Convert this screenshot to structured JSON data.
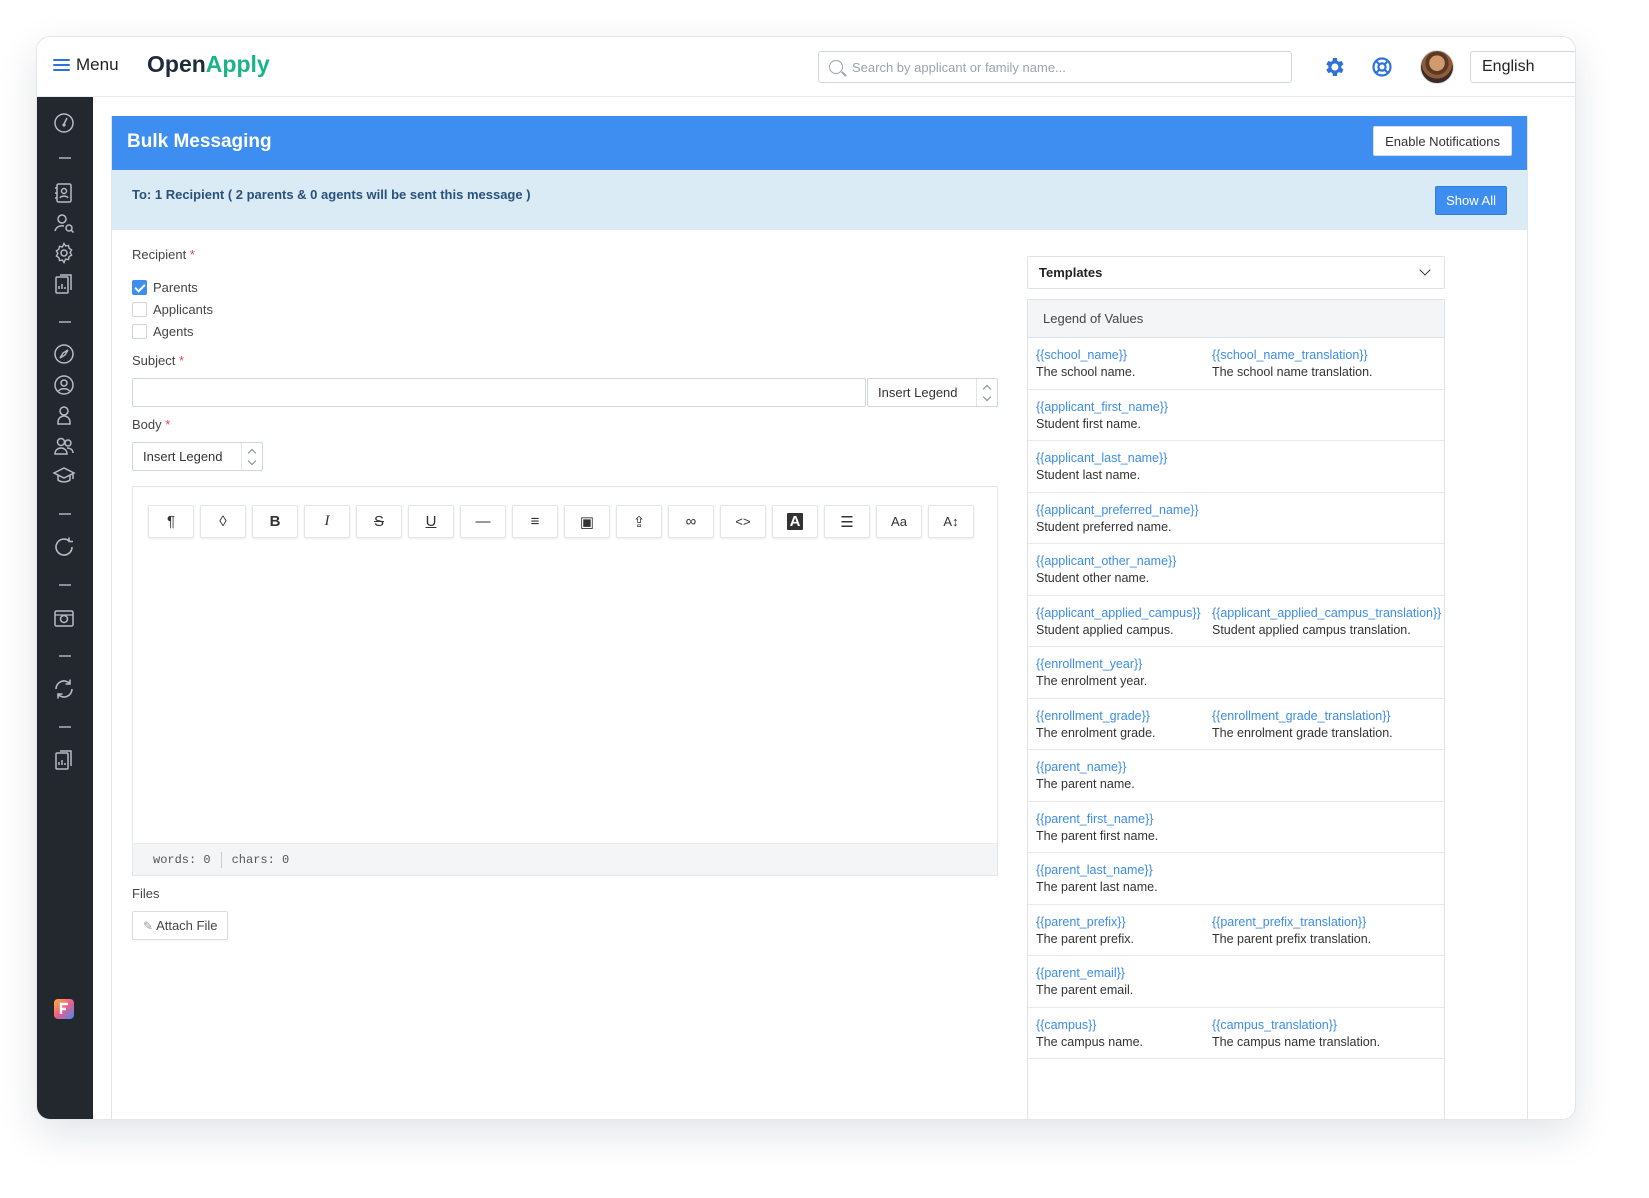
{
  "topbar": {
    "menu_label": "Menu",
    "logo_part1": "Open",
    "logo_part2": "Apply",
    "search_placeholder": "Search by applicant or family name...",
    "language": "English"
  },
  "page": {
    "title": "Bulk Messaging",
    "enable_notifications": "Enable Notifications",
    "recipient_summary": "To: 1 Recipient ( 2 parents & 0 agents will be sent this message )",
    "show_all": "Show All"
  },
  "form": {
    "recipient_label": "Recipient",
    "required_mark": "*",
    "recipients": [
      {
        "label": "Parents",
        "checked": true
      },
      {
        "label": "Applicants",
        "checked": false
      },
      {
        "label": "Agents",
        "checked": false
      }
    ],
    "subject_label": "Subject",
    "subject_value": "",
    "insert_legend": "Insert Legend",
    "body_label": "Body",
    "toolbar_glyphs": [
      "¶",
      "◊",
      "B",
      "I",
      "S",
      "U",
      "—",
      "≡",
      "▣",
      "⇪",
      "∞",
      "<>",
      "A",
      "☰",
      "Aa",
      "A↕"
    ],
    "words_label": "words: 0",
    "chars_label": "chars: 0",
    "files_label": "Files",
    "attach_file": "Attach File",
    "attach_glyph": "✎"
  },
  "templates": {
    "label": "Templates",
    "legend_title": "Legend of Values",
    "rows": [
      [
        {
          "key": "{{school_name}}",
          "desc": "The school name."
        },
        {
          "key": "{{school_name_translation}}",
          "desc": "The school name translation."
        }
      ],
      [
        {
          "key": "{{applicant_first_name}}",
          "desc": "Student first name."
        }
      ],
      [
        {
          "key": "{{applicant_last_name}}",
          "desc": "Student last name."
        }
      ],
      [
        {
          "key": "{{applicant_preferred_name}}",
          "desc": "Student preferred name."
        }
      ],
      [
        {
          "key": "{{applicant_other_name}}",
          "desc": "Student other name."
        }
      ],
      [
        {
          "key": "{{applicant_applied_campus}}",
          "desc": "Student applied campus."
        },
        {
          "key": "{{applicant_applied_campus_translation}}",
          "desc": "Student applied campus translation."
        }
      ],
      [
        {
          "key": "{{enrollment_year}}",
          "desc": "The enrolment year."
        }
      ],
      [
        {
          "key": "{{enrollment_grade}}",
          "desc": "The enrolment grade."
        },
        {
          "key": "{{enrollment_grade_translation}}",
          "desc": "The enrolment grade translation."
        }
      ],
      [
        {
          "key": "{{parent_name}}",
          "desc": "The parent name."
        }
      ],
      [
        {
          "key": "{{parent_first_name}}",
          "desc": "The parent first name."
        }
      ],
      [
        {
          "key": "{{parent_last_name}}",
          "desc": "The parent last name."
        }
      ],
      [
        {
          "key": "{{parent_prefix}}",
          "desc": "The parent prefix."
        },
        {
          "key": "{{parent_prefix_translation}}",
          "desc": "The parent prefix translation."
        }
      ],
      [
        {
          "key": "{{parent_email}}",
          "desc": "The parent email."
        }
      ],
      [
        {
          "key": "{{campus}}",
          "desc": "The campus name."
        },
        {
          "key": "{{campus_translation}}",
          "desc": "The campus name translation."
        }
      ]
    ]
  },
  "colors": {
    "accent": "#3e8ef2",
    "sidebar": "#23282f",
    "recipient_bar": "#daebf6",
    "brand_green": "#1bb38a"
  }
}
